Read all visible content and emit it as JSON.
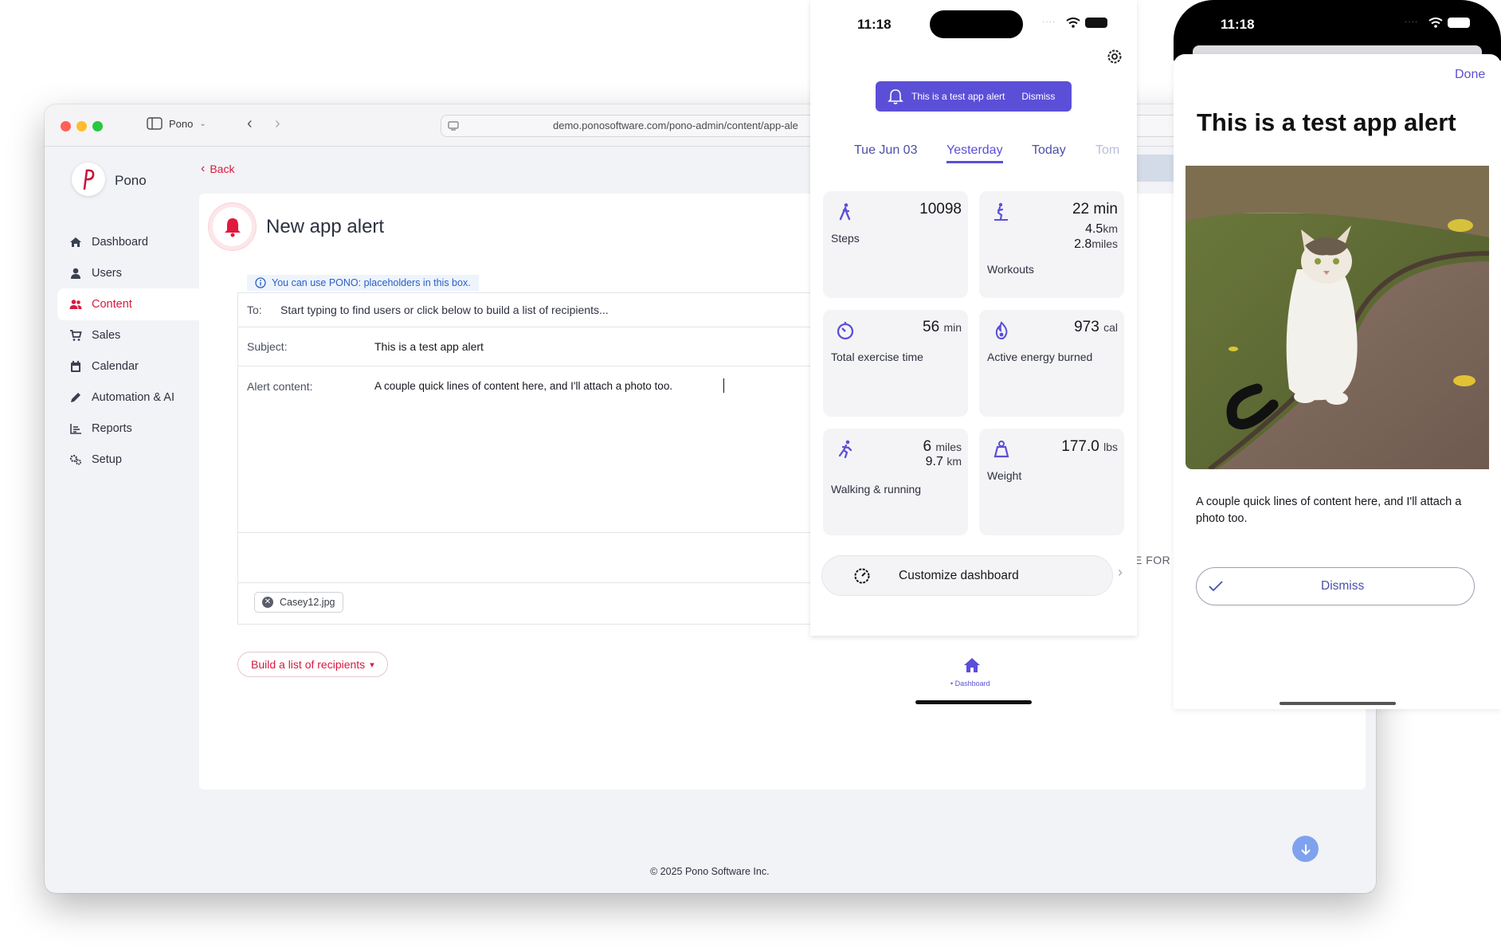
{
  "browser": {
    "app_name": "Pono",
    "url": "demo.ponosoftware.com/pono-admin/content/app-ale",
    "brand": "Pono",
    "nav": [
      {
        "label": "Dashboard",
        "icon": "home-icon"
      },
      {
        "label": "Users",
        "icon": "user-icon"
      },
      {
        "label": "Content",
        "icon": "users-icon"
      },
      {
        "label": "Sales",
        "icon": "cart-icon"
      },
      {
        "label": "Calendar",
        "icon": "calendar-icon"
      },
      {
        "label": "Automation & AI",
        "icon": "pencil-icon"
      },
      {
        "label": "Reports",
        "icon": "chart-icon"
      },
      {
        "label": "Setup",
        "icon": "gears-icon"
      }
    ],
    "back_label": "Back",
    "page_title": "New app alert",
    "hint": "You can use PONO: placeholders in this box.",
    "to_label": "To:",
    "to_placeholder": "Start typing to find users or click below to build a list of recipients...",
    "subject_label": "Subject:",
    "subject_value": "This is a test app alert",
    "content_label": "Alert content:",
    "content_value": "A couple quick lines of content here, and I'll attach a photo too.",
    "attachment": "Casey12.jpg",
    "build_list_label": "Build a list of recipients",
    "side_text": "E FOR",
    "footer": "© 2025 Pono Software Inc.",
    "accent": "#d7193f"
  },
  "phone1": {
    "time": "11:18",
    "banner_text": "This is a test app alert",
    "banner_dismiss": "Dismiss",
    "date_tabs": [
      "Tue Jun 03",
      "Yesterday",
      "Today",
      "Tom"
    ],
    "active_tab": "Yesterday",
    "tiles": [
      {
        "label": "Steps",
        "value": "10098"
      },
      {
        "label": "Workouts",
        "value": "22 min",
        "line2_num": "4.5",
        "line2_unit": "km",
        "line3_num": "2.8",
        "line3_unit": "miles"
      },
      {
        "label": "Total exercise time",
        "num": "56",
        "unit": "min"
      },
      {
        "label": "Active energy burned",
        "num": "973",
        "unit": "cal"
      },
      {
        "label": "Walking & running",
        "num": "6",
        "unit": "miles",
        "line2_num": "9.7",
        "line2_unit": "km"
      },
      {
        "label": "Weight",
        "num": "177.0",
        "unit": "lbs"
      }
    ],
    "customize_label": "Customize dashboard",
    "tabbar_label": "Dashboard",
    "accent": "#5b4fd8"
  },
  "phone2": {
    "time": "11:18",
    "done_label": "Done",
    "title": "This is a test app alert",
    "body": "A couple quick lines of content here, and I'll attach a photo too.",
    "dismiss_label": "Dismiss"
  }
}
